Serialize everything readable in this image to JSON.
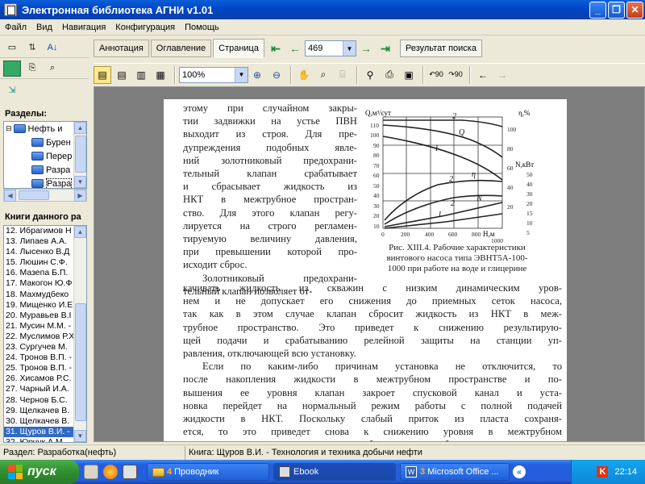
{
  "window": {
    "title": "Электронная библиотека АГНИ v1.01"
  },
  "menu": [
    "Файл",
    "Вид",
    "Навигация",
    "Конфигурация",
    "Помощь"
  ],
  "left": {
    "sections_label": "Разделы:",
    "tree": [
      {
        "label": "Нефть и",
        "level": 0
      },
      {
        "label": "Бурен",
        "level": 1
      },
      {
        "label": "Перер",
        "level": 1
      },
      {
        "label": "Разра",
        "level": 1
      },
      {
        "label": "Разра",
        "level": 1
      }
    ],
    "books_label": "Книги данного ра",
    "books": [
      "12. Ибрагимов Н",
      "13. Липаев А.А.",
      "14. Лысенко В.Д",
      "15. Люшин С.Ф.",
      "16. Мазепа Б.П.",
      "17. Макогон Ю.Ф",
      "18. Махмудбеко",
      "19. Мищенко И.Е",
      "20. Муравьев В.I",
      "21. Мусин М.М. -",
      "22. Муслимов Р.Х",
      "23. Сургучев М.",
      "24. Тронов В.П. -",
      "25. Тронов В.П. -",
      "26. Хисамов Р.С.",
      "27. Чарный И.А.",
      "28. Чернов Б.С.",
      "29. Щелкачев В.",
      "30. Щелкачев В.",
      "31. Щуров В.И. -",
      "32. Юрчук А.М."
    ],
    "selected_book_index": 19
  },
  "tabs": {
    "annotation": "Аннотация",
    "contents": "Оглавление",
    "page": "Страница"
  },
  "page_number": "469",
  "search_result_label": "Результат поиска",
  "zoom": "100%",
  "document": {
    "left_column": [
      "этому при случайном закры-",
      "тии задвижки на устье ПВН",
      "выходит из строя. Для пре-",
      "дупреждения подобных явле-",
      "ний золотниковый предохрани-",
      "тельный клапан срабатывает",
      "и сбрасывает жидкость из",
      "НКТ в межтрубное простран-",
      "ство. Для этого клапан регу-",
      "лируется на строго регламен-",
      "тируемую величину давления,",
      "при превышении которой про-",
      "исходит сброс.",
      "Золотниковый предохрани-",
      "тельный клапан позволяет от-"
    ],
    "full_lines": [
      "качивать жидкость из скважин с низким динамическим уров-",
      "нем и не допускает его снижения до приемных сеток насоса,",
      "так как в этом случае клапан сбросит жидкость из НКТ в меж-",
      "трубное пространство. Это приведет к снижению результирую-",
      "щей подачи и срабатыванию релейной защиты на станции уп-",
      "равления, отключающей всю установку.",
      "Если по каким-либо причинам установка не отключится, то",
      "после накопления жидкости в межтрубном пространстве и по-",
      "вышения ее уровня клапан закроет спусковой канал и уста-",
      "новка перейдет на нормальный режим работы с полной подачей",
      "жидкости в НКТ. Поскольку слабый приток из пласта сохраня-",
      "ется, то это приведет снова к снижению уровня в межтрубном",
      "пространстве, клапан снова сработает и сбросит жидкость из"
    ],
    "caption": [
      "Рис. XIII.4. Рабочие характеристики",
      "винтового насоса типа ЭВНТ5А-100-",
      "1000 при работе на воде и глицерине"
    ],
    "figure": {
      "q_unit": "Q,м³/сут",
      "eta_unit": "η,%",
      "n_unit": "N,кВт",
      "h_unit": "Н,м",
      "q_ticks": [
        "10",
        "20",
        "30",
        "40",
        "50",
        "60",
        "70",
        "80",
        "90",
        "100",
        "110"
      ],
      "eta_ticks": [
        "100",
        "80",
        "60",
        "40",
        "20"
      ],
      "n_ticks": [
        "50",
        "40",
        "30",
        "20",
        "15",
        "10",
        "5"
      ],
      "h_ticks": [
        "0",
        "200",
        "400",
        "600",
        "800",
        "1000"
      ],
      "curve_labels": {
        "q": "Q",
        "eta": "η",
        "n": "N",
        "one": "1",
        "two": "2"
      }
    }
  },
  "status": {
    "section": "Раздел: Разработка(нефть)",
    "book": "Книга: Щуров В.И. - Технология и техника добычи нефти"
  },
  "taskbar": {
    "start": "пуск",
    "tasks": [
      {
        "num": "4",
        "label": "Проводник"
      },
      {
        "num": "",
        "label": "Ebook"
      },
      {
        "num": "3",
        "label": "Microsoft Office ..."
      }
    ],
    "clock": "22:14"
  }
}
